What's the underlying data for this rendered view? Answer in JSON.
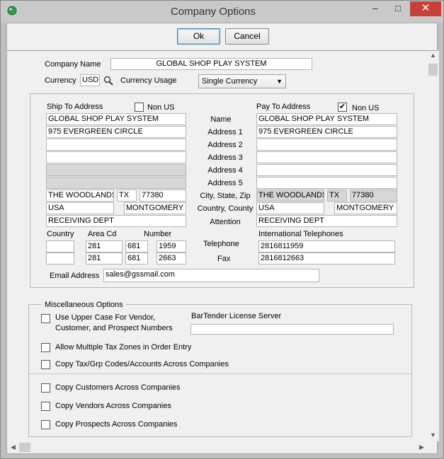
{
  "window": {
    "title": "Company Options",
    "minimize": "–",
    "maximize": "□",
    "close": "✕"
  },
  "buttons": {
    "ok": "Ok",
    "cancel": "Cancel"
  },
  "company": {
    "name_label": "Company Name",
    "name_value": "GLOBAL SHOP PLAY SYSTEM",
    "currency_label": "Currency",
    "currency_value": "USD",
    "currency_usage_label": "Currency Usage",
    "currency_usage_value": "Single Currency"
  },
  "ship_to": {
    "header": "Ship To Address",
    "non_us_label": "Non US",
    "non_us_checked": false,
    "name": "GLOBAL SHOP PLAY SYSTEM",
    "address1": "975 EVERGREEN CIRCLE",
    "address2": "",
    "address3": "",
    "address4": "",
    "address5": "",
    "city": "THE WOODLANDS",
    "state": "TX",
    "zip": "77380",
    "country": "USA",
    "county": "MONTGOMERY",
    "attention": "RECEIVING DEPT"
  },
  "pay_to": {
    "header": "Pay To Address",
    "non_us_label": "Non US",
    "non_us_checked": true,
    "non_us_mark": "✔",
    "name": "GLOBAL SHOP PLAY SYSTEM",
    "address1": "975 EVERGREEN CIRCLE",
    "address2": "",
    "address3": "",
    "address4": "",
    "address5": "",
    "city": "THE WOODLANDS",
    "state": "TX",
    "zip": "77380",
    "country": "USA",
    "county": "MONTGOMERY",
    "attention": "RECEIVING DEPT"
  },
  "row_labels": {
    "name": "Name",
    "address1": "Address 1",
    "address2": "Address 2",
    "address3": "Address 3",
    "address4": "Address 4",
    "address5": "Address 5",
    "city_state_zip": "City, State, Zip",
    "country_county": "Country, County",
    "attention": "Attention"
  },
  "phones": {
    "country_label": "Country",
    "area_label": "Area Cd",
    "number_label": "Number",
    "intl_label": "International Telephones",
    "telephone_label": "Telephone",
    "fax_label": "Fax",
    "telephone": {
      "country": "",
      "area": "281",
      "prefix": "681",
      "line": "1959",
      "intl": "2816811959"
    },
    "fax": {
      "country": "",
      "area": "281",
      "prefix": "681",
      "line": "2663",
      "intl": "2816812663"
    }
  },
  "email": {
    "label": "Email Address",
    "value": "sales@gssmail.com"
  },
  "misc": {
    "header": "Miscellaneous Options",
    "upper_case_line1": "Use Upper Case For Vendor,",
    "upper_case_line2": "Customer, and Prospect Numbers",
    "bartender_label": "BarTender License Server",
    "bartender_value": "",
    "multi_tax": "Allow Multiple Tax Zones in Order Entry",
    "copy_tax": "Copy Tax/Grp Codes/Accounts Across Companies",
    "copy_customers": "Copy Customers Across Companies",
    "copy_vendors": "Copy Vendors Across Companies",
    "copy_prospects": "Copy Prospects Across Companies"
  },
  "icons": {
    "search": "search-icon",
    "app": "globe-icon",
    "dropdown": "chevron-down-icon"
  }
}
